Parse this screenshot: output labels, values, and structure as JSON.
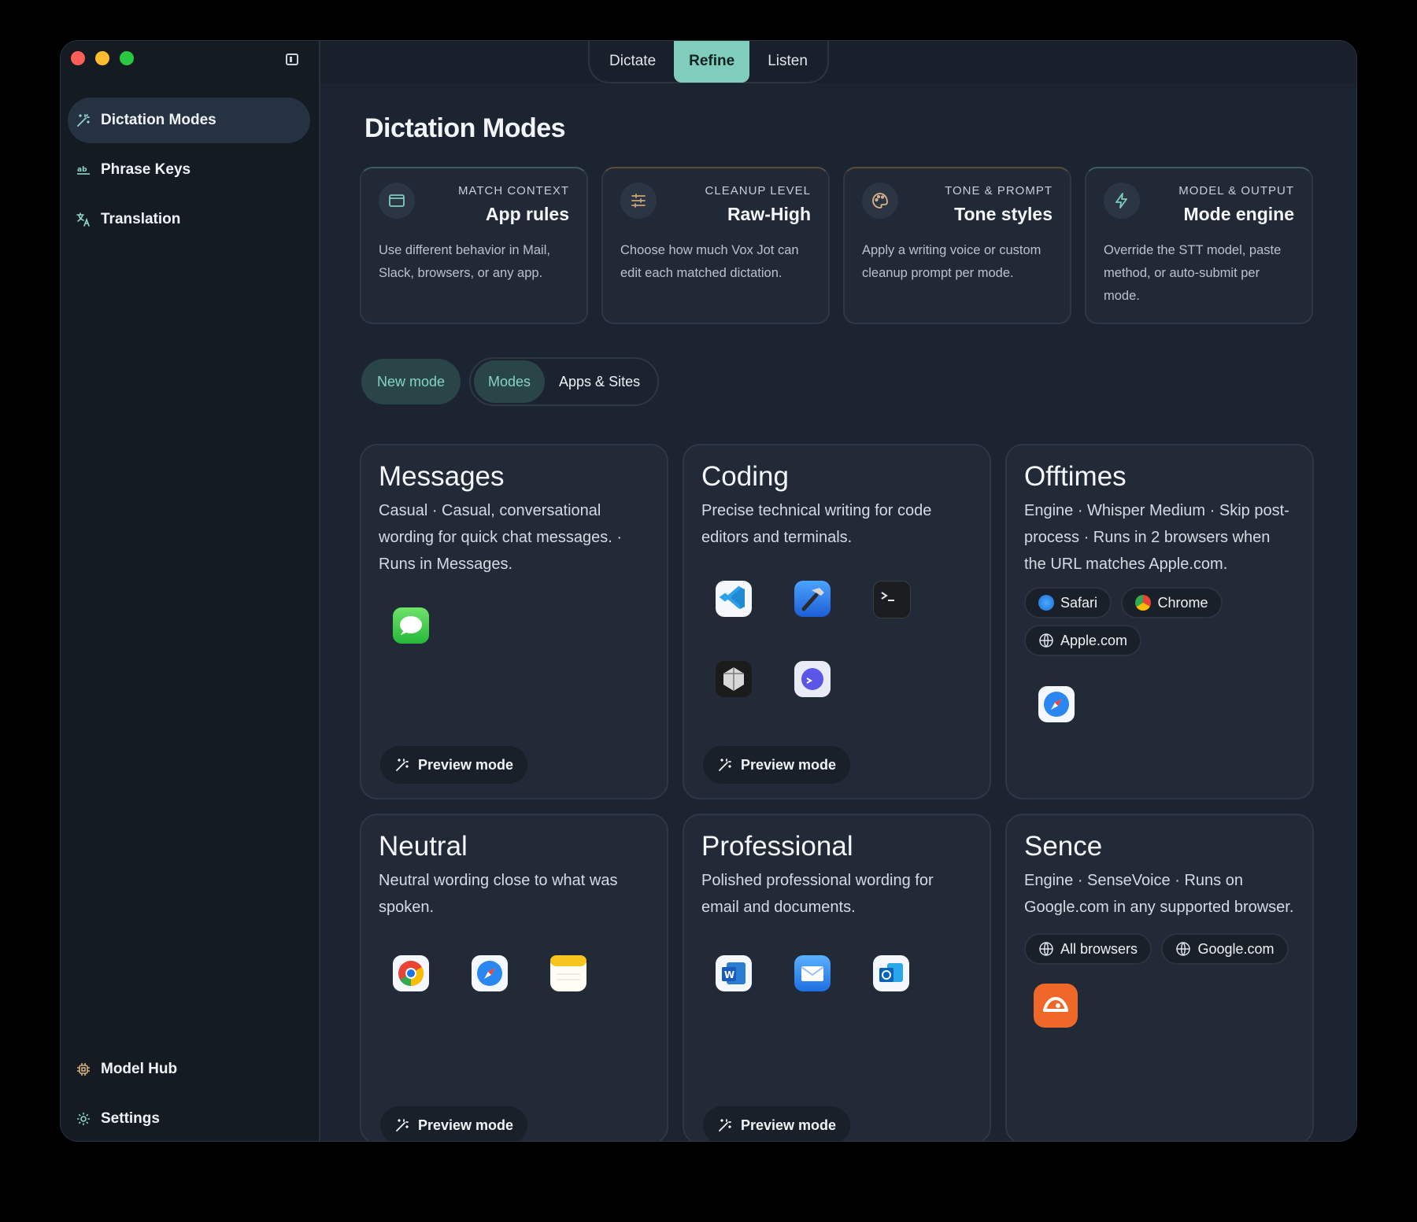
{
  "window": {
    "traffic_lights": [
      "close",
      "minimize",
      "zoom"
    ]
  },
  "sidebar": {
    "items": [
      {
        "label": "Dictation Modes",
        "icon": "magic-wand-icon",
        "active": true
      },
      {
        "label": "Phrase Keys",
        "icon": "ab-keyboard-icon",
        "active": false
      },
      {
        "label": "Translation",
        "icon": "translate-icon",
        "active": false
      }
    ],
    "bottom_items": [
      {
        "label": "Model Hub",
        "icon": "chip-icon"
      },
      {
        "label": "Settings",
        "icon": "gear-icon"
      }
    ]
  },
  "topbar": {
    "tabs": [
      "Dictate",
      "Refine",
      "Listen"
    ],
    "active_tab": "Refine"
  },
  "page": {
    "title": "Dictation Modes"
  },
  "features": [
    {
      "kicker": "MATCH CONTEXT",
      "title": "App rules",
      "desc": "Use different behavior in Mail, Slack, browsers, or any app.",
      "icon": "window-icon",
      "accent": "#7fcdbd"
    },
    {
      "kicker": "CLEANUP LEVEL",
      "title": "Raw-High",
      "desc": "Choose how much Vox Jot can edit each matched dictation.",
      "icon": "sliders-icon",
      "accent": "#c9a57a"
    },
    {
      "kicker": "TONE & PROMPT",
      "title": "Tone styles",
      "desc": "Apply a writing voice or custom cleanup prompt per mode.",
      "icon": "palette-icon",
      "accent": "#d9b48a"
    },
    {
      "kicker": "MODEL & OUTPUT",
      "title": "Mode engine",
      "desc": "Override the STT model, paste method, or auto-submit per mode.",
      "icon": "bolt-icon",
      "accent": "#7fcdbd"
    }
  ],
  "controls": {
    "new_mode": "New mode",
    "filters": [
      "Modes",
      "Apps & Sites"
    ],
    "active_filter": "Modes"
  },
  "cards": [
    {
      "title": "Messages",
      "desc": "Casual · Casual, conversational wording for quick chat messages. · Runs in Messages.",
      "apps": [
        "messages-app-icon"
      ],
      "preview": "Preview mode"
    },
    {
      "title": "Coding",
      "desc": "Precise technical writing for code editors and terminals.",
      "apps": [
        "vscode-app-icon",
        "xcode-app-icon",
        "terminal-app-icon",
        "cursor-app-icon",
        "warp-app-icon"
      ],
      "preview": "Preview mode"
    },
    {
      "title": "Offtimes",
      "desc": "Engine · Whisper Medium · Skip post-process · Runs in 2 browsers when the URL matches Apple.com.",
      "chips": [
        "Safari",
        "Chrome",
        "Apple.com"
      ],
      "apps": [
        "safari-app-icon"
      ]
    },
    {
      "title": "Neutral",
      "desc": "Neutral wording close to what was spoken.",
      "apps": [
        "chrome-app-icon",
        "safari-app-icon",
        "notes-app-icon"
      ],
      "preview": "Preview mode"
    },
    {
      "title": "Professional",
      "desc": "Polished professional wording for email and documents.",
      "apps": [
        "word-app-icon",
        "mail-app-icon",
        "outlook-app-icon"
      ],
      "preview": "Preview mode"
    },
    {
      "title": "Sence",
      "desc": "Engine · SenseVoice · Runs on Google.com in any supported browser.",
      "chips": [
        "All browsers",
        "Google.com"
      ],
      "apps": [
        "sense-app-icon"
      ]
    }
  ],
  "colors": {
    "accent": "#80cdbd",
    "background": "#1d2431",
    "sidebar": "#151b23",
    "card": "#222a38"
  }
}
